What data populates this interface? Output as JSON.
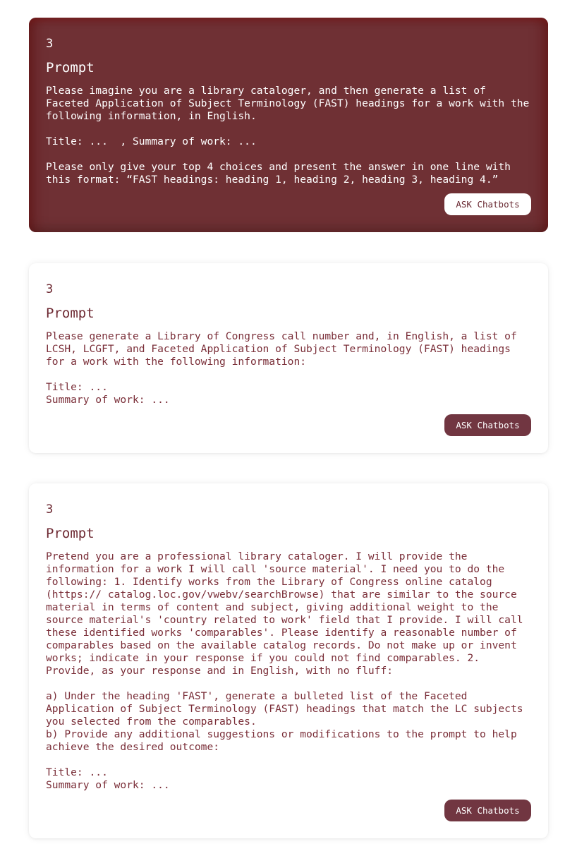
{
  "cards": [
    {
      "number": "3",
      "title": "Prompt",
      "body": "Please imagine you are a library cataloger, and then generate a list of Faceted Application of Subject Terminology (FAST) headings for a work with the following information, in English.\n\nTitle: ...  , Summary of work: ...\n\nPlease only give your top 4 choices and present the answer in one line with this format: “FAST headings: heading 1, heading 2, heading 3, heading 4.”",
      "button_label": "ASK Chatbots"
    },
    {
      "number": "3",
      "title": "Prompt",
      "body": "Please generate a Library of Congress call number and, in English, a list of LCSH, LCGFT, and Faceted Application of Subject Terminology (FAST) headings for a work with the following information:\n\nTitle: ...\nSummary of work: ...",
      "button_label": "ASK Chatbots"
    },
    {
      "number": "3",
      "title": "Prompt",
      "body": "Pretend you are a professional library cataloger. I will provide the information for a work I will call 'source material'. I need you to do the following: 1. Identify works from the Library of Congress online catalog (https:// catalog.loc.gov/vwebv/searchBrowse) that are similar to the source material in terms of content and subject, giving additional weight to the source material's 'country related to work' field that I provide. I will call these identified works 'comparables'. Please identify a reasonable number of comparables based on the available catalog records. Do not make up or invent works; indicate in your response if you could not find comparables. 2. Provide, as your response and in English, with no fluff:\n\na) Under the heading 'FAST', generate a bulleted list of the Faceted Application of Subject Terminology (FAST) headings that match the LC subjects you selected from the comparables.\nb) Provide any additional suggestions or modifications to the prompt to help achieve the desired outcome:\n\nTitle: ...\nSummary of work: ...",
      "button_label": "ASK Chatbots"
    }
  ],
  "colors": {
    "accent": "#713641",
    "active_card_bg": "#6f3034",
    "text_maroon": "#7a2e38"
  }
}
